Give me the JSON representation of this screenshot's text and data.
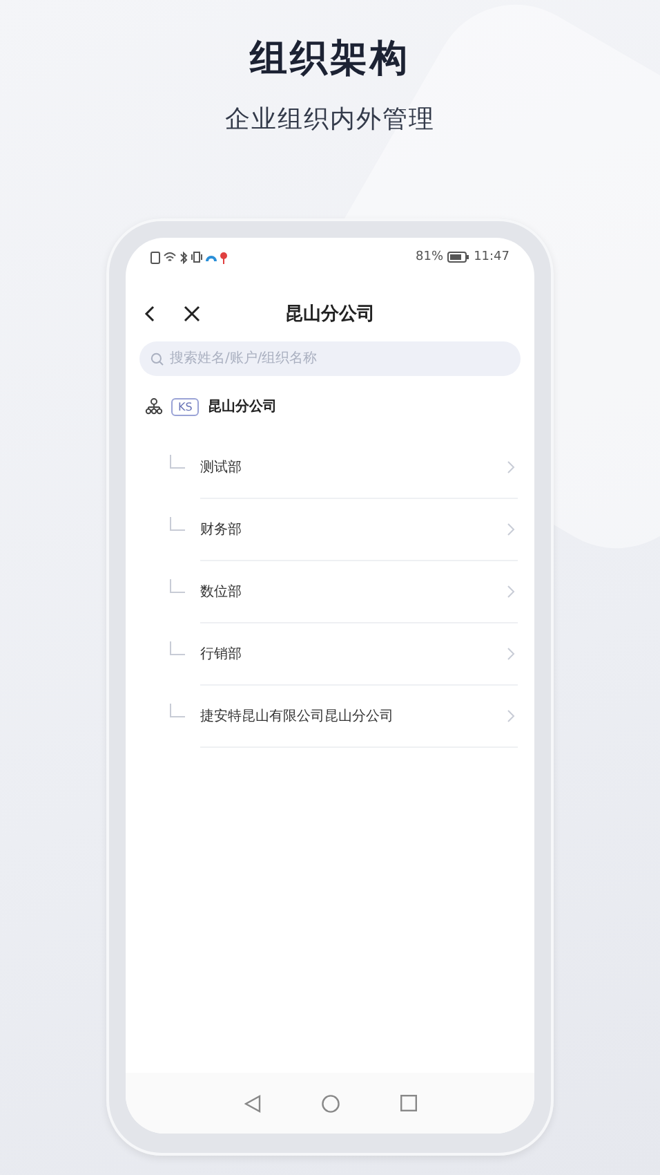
{
  "header": {
    "title": "组织架构",
    "subtitle": "企业组织内外管理"
  },
  "status_bar": {
    "battery": "81%",
    "time": "11:47"
  },
  "nav": {
    "title": "昆山分公司"
  },
  "search": {
    "placeholder": "搜索姓名/账户/组织名称"
  },
  "tree": {
    "badge": "KS",
    "name": "昆山分公司",
    "children": [
      {
        "name": "测试部"
      },
      {
        "name": "财务部"
      },
      {
        "name": "数位部"
      },
      {
        "name": "行销部"
      },
      {
        "name": "捷安特昆山有限公司昆山分公司"
      }
    ]
  }
}
